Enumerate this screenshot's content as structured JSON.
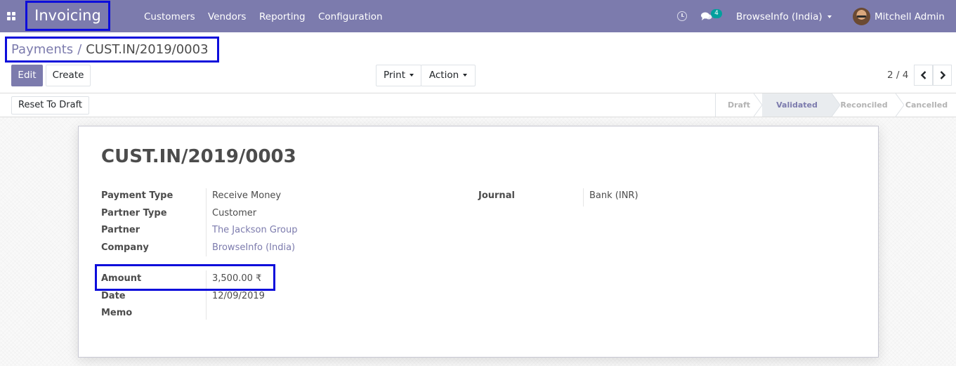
{
  "navbar": {
    "app_name": "Invoicing",
    "menu": [
      "Customers",
      "Vendors",
      "Reporting",
      "Configuration"
    ],
    "messages_count": "4",
    "company": "BrowseInfo (India)",
    "user": "Mitchell Admin",
    "accent_color": "#7c7bad"
  },
  "breadcrumb": {
    "parent": "Payments",
    "separator": "/",
    "current": "CUST.IN/2019/0003"
  },
  "buttons": {
    "edit": "Edit",
    "create": "Create",
    "print": "Print",
    "action": "Action",
    "reset_to_draft": "Reset To Draft"
  },
  "pager": {
    "value": "2 / 4"
  },
  "status_stages": {
    "items": [
      "Draft",
      "Validated",
      "Reconciled",
      "Cancelled"
    ],
    "active": "Validated"
  },
  "record": {
    "title": "CUST.IN/2019/0003",
    "fields": {
      "payment_type": {
        "label": "Payment Type",
        "value": "Receive Money"
      },
      "partner_type": {
        "label": "Partner Type",
        "value": "Customer"
      },
      "partner": {
        "label": "Partner",
        "value": "The Jackson Group"
      },
      "company": {
        "label": "Company",
        "value": "BrowseInfo (India)"
      },
      "amount": {
        "label": "Amount",
        "value": "3,500.00 ₹"
      },
      "date": {
        "label": "Date",
        "value": "12/09/2019"
      },
      "memo": {
        "label": "Memo",
        "value": ""
      },
      "journal": {
        "label": "Journal",
        "value": "Bank (INR)"
      }
    }
  },
  "highlight_color": "#0d0ddb"
}
